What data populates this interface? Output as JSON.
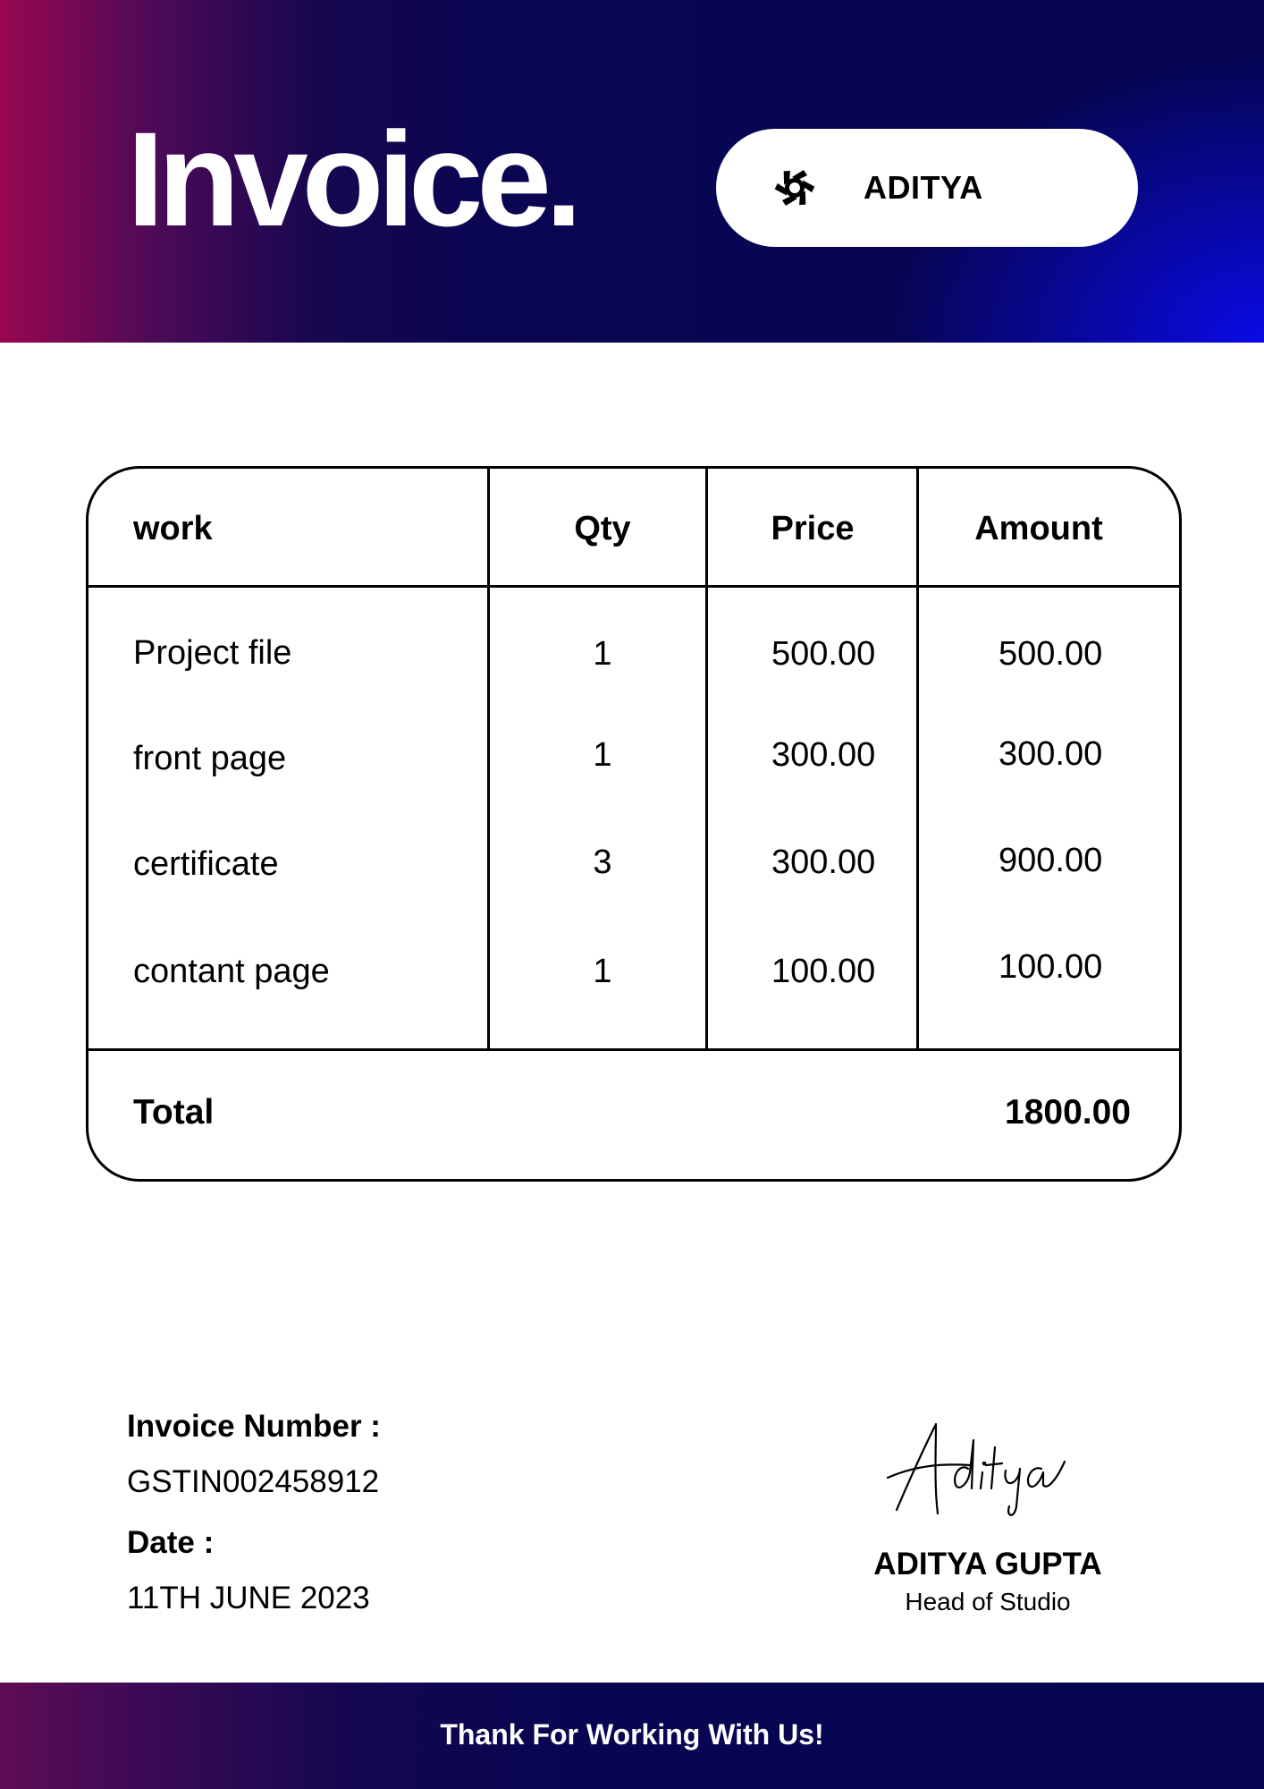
{
  "header": {
    "title": "Invoice.",
    "brand": {
      "name": "ADITYA",
      "icon": "aperture-icon"
    }
  },
  "colors": {
    "header_dark": "#050552",
    "header_accent_left": "#9a0750",
    "header_accent_right": "#0a0ae6",
    "text": "#000000",
    "background": "#ffffff"
  },
  "table": {
    "columns": [
      "work",
      "Qty",
      "Price",
      "Amount"
    ],
    "rows": [
      {
        "work": "Project file",
        "qty": "1",
        "price": "500.00",
        "amount": "500.00"
      },
      {
        "work": "front page",
        "qty": "1",
        "price": "300.00",
        "amount": "300.00"
      },
      {
        "work": "certificate",
        "qty": "3",
        "price": "300.00",
        "amount": "900.00"
      },
      {
        "work": "contant page",
        "qty": "1",
        "price": "100.00",
        "amount": "100.00"
      }
    ],
    "total_label": "Total",
    "total_value": "1800.00"
  },
  "details": {
    "invoice_number_label": "Invoice Number :",
    "invoice_number": "GSTIN002458912",
    "date_label": "Date :",
    "date": "11TH JUNE 2023"
  },
  "signature": {
    "script": "Aditya",
    "name": "ADITYA GUPTA",
    "title": "Head of Studio"
  },
  "footer": {
    "message": "Thank For Working With Us!"
  }
}
